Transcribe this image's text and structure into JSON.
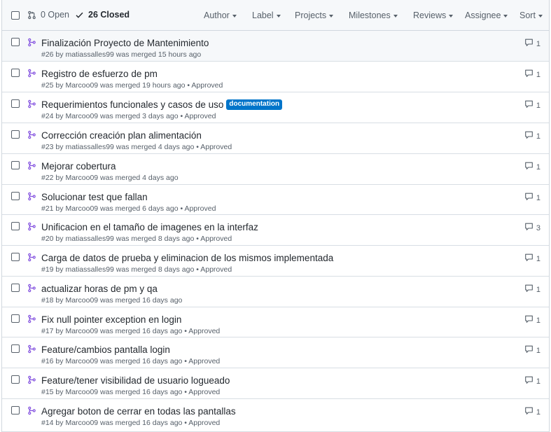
{
  "header": {
    "open_label": "0 Open",
    "closed_label": "26 Closed",
    "filters": [
      "Author",
      "Label",
      "Projects",
      "Milestones",
      "Reviews",
      "Assignee",
      "Sort"
    ]
  },
  "colors": {
    "merged": "#8250df",
    "label_documentation": "#0075ca"
  },
  "pulls": [
    {
      "title": "Finalización Proyecto de Mantenimiento",
      "meta": "#26 by matiassalles99 was merged 15 hours ago",
      "comments": "1",
      "label": ""
    },
    {
      "title": "Registro de esfuerzo de pm",
      "meta": "#25 by Marcoo09 was merged 19 hours ago • Approved",
      "comments": "1",
      "label": ""
    },
    {
      "title": "Requerimientos funcionales y casos de uso",
      "meta": "#24 by Marcoo09 was merged 3 days ago • Approved",
      "comments": "1",
      "label": "documentation"
    },
    {
      "title": "Corrección creación plan alimentación",
      "meta": "#23 by matiassalles99 was merged 4 days ago • Approved",
      "comments": "1",
      "label": ""
    },
    {
      "title": "Mejorar cobertura",
      "meta": "#22 by Marcoo09 was merged 4 days ago",
      "comments": "1",
      "label": ""
    },
    {
      "title": "Solucionar test que fallan",
      "meta": "#21 by Marcoo09 was merged 6 days ago • Approved",
      "comments": "1",
      "label": ""
    },
    {
      "title": "Unificacion en el tamaño de imagenes en la interfaz",
      "meta": "#20 by matiassalles99 was merged 8 days ago • Approved",
      "comments": "3",
      "label": ""
    },
    {
      "title": "Carga de datos de prueba y eliminacion de los mismos implementada",
      "meta": "#19 by matiassalles99 was merged 8 days ago • Approved",
      "comments": "1",
      "label": ""
    },
    {
      "title": "actualizar horas de pm y qa",
      "meta": "#18 by Marcoo09 was merged 16 days ago",
      "comments": "1",
      "label": ""
    },
    {
      "title": "Fix null pointer exception en login",
      "meta": "#17 by Marcoo09 was merged 16 days ago • Approved",
      "comments": "1",
      "label": ""
    },
    {
      "title": "Feature/cambios pantalla login",
      "meta": "#16 by Marcoo09 was merged 16 days ago • Approved",
      "comments": "1",
      "label": ""
    },
    {
      "title": "Feature/tener visibilidad de usuario logueado",
      "meta": "#15 by Marcoo09 was merged 16 days ago • Approved",
      "comments": "1",
      "label": ""
    },
    {
      "title": "Agregar boton de cerrar en todas las pantallas",
      "meta": "#14 by Marcoo09 was merged 16 days ago • Approved",
      "comments": "1",
      "label": ""
    }
  ]
}
